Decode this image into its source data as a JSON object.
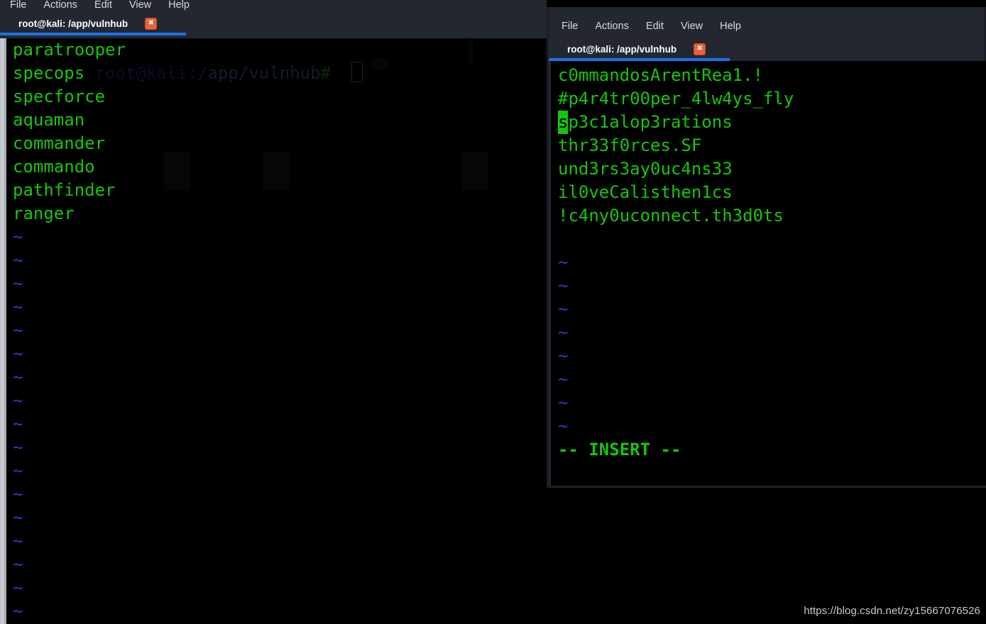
{
  "watermark": "https://blog.csdn.net/zy15667076526",
  "left_window": {
    "menu": [
      {
        "label": "File"
      },
      {
        "label": "Actions"
      },
      {
        "label": "Edit"
      },
      {
        "label": "View"
      },
      {
        "label": "Help"
      }
    ],
    "tab": {
      "title": "root@kali: /app/vulnhub",
      "close_icon": "close-icon",
      "close_glyph": "✖"
    },
    "ghost_prompt": {
      "host": "root@kali:/",
      "path": "app/vulnhub",
      "hash": "#"
    },
    "terminal": {
      "lines": [
        "paratrooper",
        "specops",
        "specforce",
        "aquaman",
        "commander",
        "commando",
        "pathfinder",
        "ranger"
      ],
      "cursor_line_index": 4,
      "cursor_char_index": 9,
      "tilde": "~",
      "tilde_count": 17
    }
  },
  "right_window": {
    "menu": [
      {
        "label": "File"
      },
      {
        "label": "Actions"
      },
      {
        "label": "Edit"
      },
      {
        "label": "View"
      },
      {
        "label": "Help"
      }
    ],
    "tab": {
      "title": "root@kali: /app/vulnhub",
      "close_icon": "close-icon",
      "close_glyph": "✖"
    },
    "terminal": {
      "lines": [
        "c0mmandosArentRea1.!",
        "#p4r4tr00per_4lw4ys_fly",
        "sp3c1alop3rations",
        "thr33f0rces.SF",
        "und3rs3ay0uc4ns33",
        "il0veCalisthen1cs",
        "!c4ny0uconnect.th3d0ts"
      ],
      "cursor_line_index": 2,
      "cursor_char_index": 0,
      "tilde": "~",
      "tilde_count": 8,
      "status": "-- INSERT --"
    }
  },
  "colors": {
    "terminal_bg": "#000000",
    "terminal_green": "#16c60c",
    "tilde_blue": "#3b32d8",
    "titlebar_bg": "#23272f",
    "tab_underline": "#1a73e8",
    "close_button": "#e8603c",
    "menu_text": "#d6dae0",
    "tab_text": "#ffffff",
    "watermark_text": "#c9c9c9"
  }
}
